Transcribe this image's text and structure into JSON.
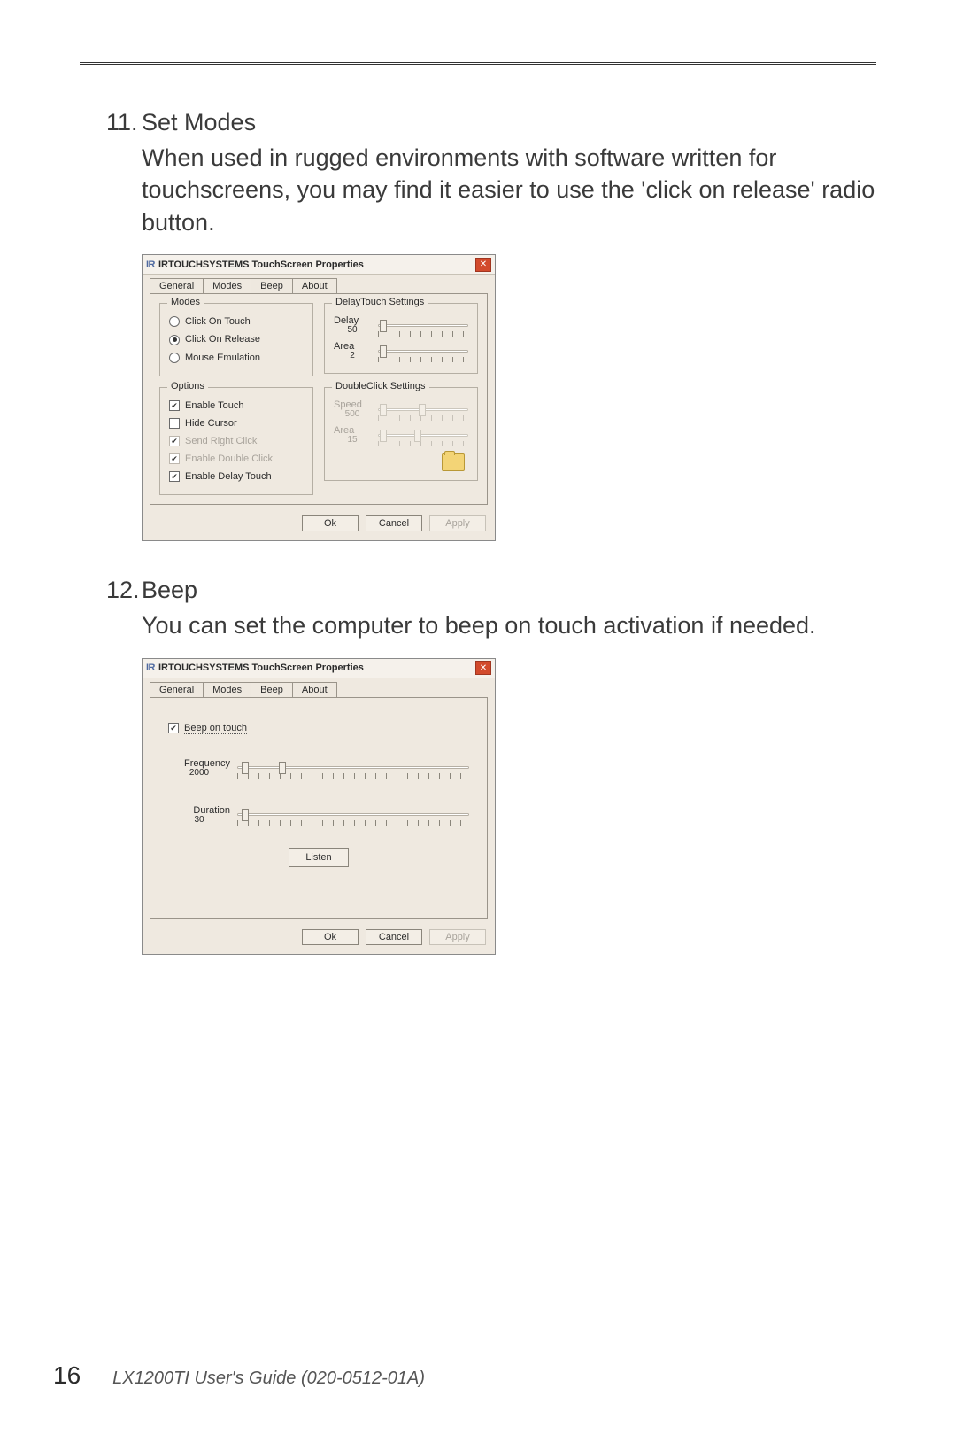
{
  "section11": {
    "number": "11.",
    "title": "Set Modes",
    "body": "When used in rugged environments with software written for touchscreens, you may find it easier to use the 'click on release' radio button."
  },
  "section12": {
    "number": "12.",
    "title": "Beep",
    "body": "You can set the computer to beep on touch activation if needed."
  },
  "dialog1": {
    "window_title": "IRTOUCHSYSTEMS TouchScreen Properties",
    "logo": "IR",
    "tabs": {
      "general": "General",
      "modes": "Modes",
      "beep": "Beep",
      "about": "About"
    },
    "modes": {
      "legend": "Modes",
      "click_on_touch": "Click On Touch",
      "click_on_release": "Click On Release",
      "mouse_emulation": "Mouse Emulation"
    },
    "delay": {
      "legend": "DelayTouch Settings",
      "delay_label": "Delay",
      "delay_value": "50",
      "area_label": "Area",
      "area_value": "2"
    },
    "options": {
      "legend": "Options",
      "enable_touch": "Enable Touch",
      "hide_cursor": "Hide Cursor",
      "send_right_click": "Send Right Click",
      "enable_double_click": "Enable Double Click",
      "enable_delay_touch": "Enable Delay Touch"
    },
    "dbl": {
      "legend": "DoubleClick Settings",
      "speed_label": "Speed",
      "speed_value": "500",
      "area_label": "Area",
      "area_value": "15"
    },
    "buttons": {
      "ok": "Ok",
      "cancel": "Cancel",
      "apply": "Apply"
    }
  },
  "dialog2": {
    "window_title": "IRTOUCHSYSTEMS TouchScreen Properties",
    "logo": "IR",
    "tabs": {
      "general": "General",
      "modes": "Modes",
      "beep": "Beep",
      "about": "About"
    },
    "beep_on_touch": "Beep on touch",
    "frequency_label": "Frequency",
    "frequency_value": "2000",
    "duration_label": "Duration",
    "duration_value": "30",
    "listen": "Listen",
    "buttons": {
      "ok": "Ok",
      "cancel": "Cancel",
      "apply": "Apply"
    }
  },
  "footer": {
    "page": "16",
    "text": "LX1200TI User's Guide (020-0512-01A)"
  }
}
